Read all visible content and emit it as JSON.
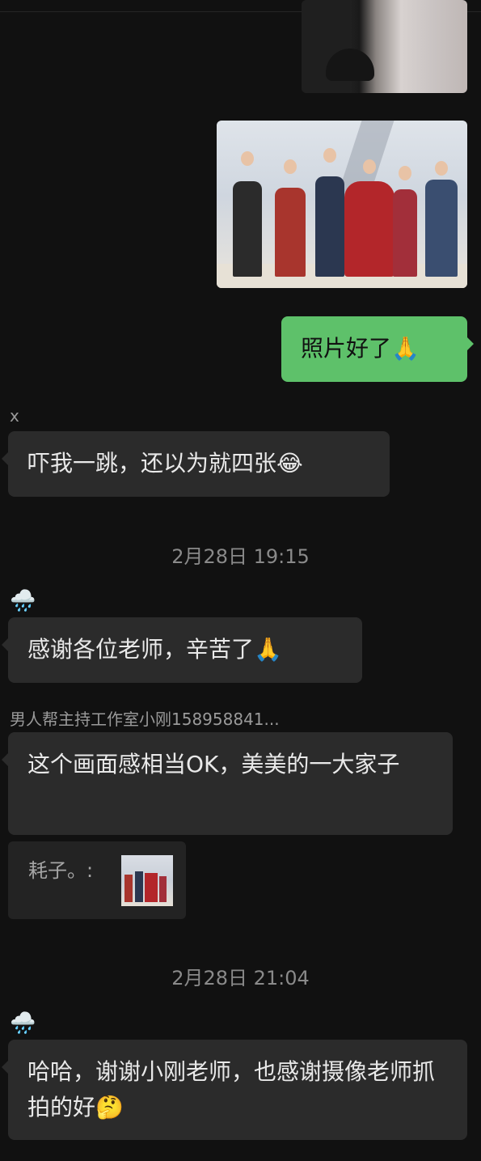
{
  "messages": {
    "sent_text": "照片好了🙏",
    "msg1_sender": "x",
    "msg1_text": "吓我一跳，还以为就四张😂",
    "time1": "2月28日 19:15",
    "msg2_sender_icon": "🌧️",
    "msg2_text": "感谢各位老师，辛苦了🙏",
    "msg3_sender": "男人帮主持工作室小刚158958841...",
    "msg3_text": "这个画面感相当OK，美美的一大家子",
    "quote_text": "耗子。:",
    "time2": "2月28日 21:04",
    "msg4_sender_icon": "🌧️",
    "msg4_text": "哈哈，谢谢小刚老师，也感谢摄像老师抓拍的好🤔"
  },
  "colors": {
    "background": "#111111",
    "bubble_left": "#2b2b2b",
    "bubble_right": "#5ec16a"
  }
}
